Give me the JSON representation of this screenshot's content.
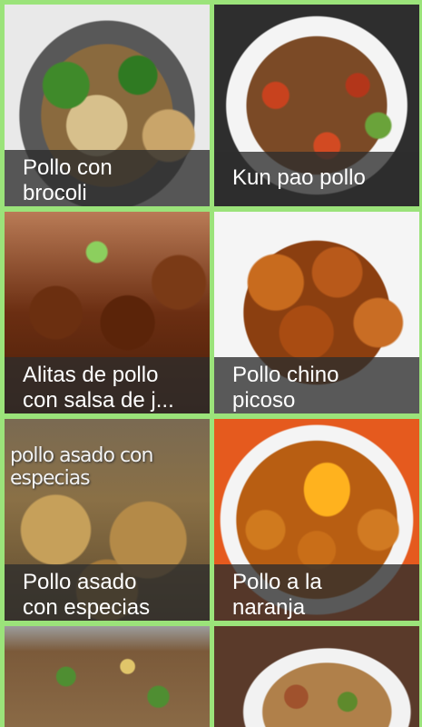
{
  "recipes": [
    {
      "title": "Pollo con\nbrocoli",
      "image_icon": "broccoli-chicken-photo"
    },
    {
      "title": "Kun pao pollo",
      "image_icon": "kung-pao-photo"
    },
    {
      "title": "Alitas de pollo\ncon salsa de j...",
      "image_icon": "chicken-wings-photo"
    },
    {
      "title": "Pollo chino\npicoso",
      "image_icon": "spicy-chinese-chicken-photo"
    },
    {
      "title": "Pollo asado\ncon especias",
      "image_icon": "roast-chicken-photo",
      "image_overlay_text": "pollo asado con especias"
    },
    {
      "title": "Pollo a la\nnaranja",
      "image_icon": "orange-chicken-photo"
    },
    {
      "title": "",
      "image_icon": "fried-rice-photo"
    },
    {
      "title": "",
      "image_icon": "rice-bowl-photo"
    }
  ],
  "colors": {
    "background": "#9be37a",
    "caption_bg": "rgba(45,45,45,0.78)",
    "caption_text": "#ffffff"
  }
}
